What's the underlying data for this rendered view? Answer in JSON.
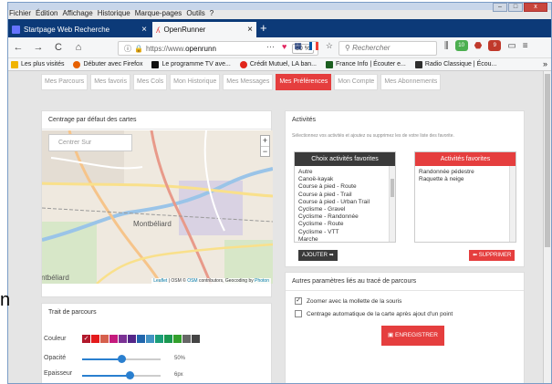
{
  "window": {
    "controls": [
      "–",
      "□",
      "x"
    ]
  },
  "menu": [
    "Fichier",
    "Édition",
    "Affichage",
    "Historique",
    "Marque-pages",
    "Outils",
    "?"
  ],
  "tabs": [
    {
      "label": "Startpage Web Recherche",
      "active": false
    },
    {
      "label": "OpenRunner",
      "active": true
    }
  ],
  "nav": {
    "back": "←",
    "forward": "→",
    "reload": "C",
    "home": "⌂",
    "url_prefix": "https://www.",
    "url_host": "openrunn",
    "zoom": "80 %",
    "more": "···",
    "search_placeholder": "Rechercher",
    "badge1": "10",
    "badge2": "9"
  },
  "bookmarks": [
    {
      "label": "Les plus visités",
      "icon": "star-icon",
      "color": "#f0b400"
    },
    {
      "label": "Débuter avec Firefox",
      "icon": "firefox-icon",
      "color": "#e66000"
    },
    {
      "label": "Le programme TV ave...",
      "icon": "tv-icon",
      "color": "#111111"
    },
    {
      "label": "Crédit Mutuel, LA ban...",
      "icon": "bank-icon",
      "color": "#e1251b"
    },
    {
      "label": "France Info | Écouter e...",
      "icon": "radio-icon",
      "color": "#1b5e20"
    },
    {
      "label": "Radio Classique | Écou...",
      "icon": "radio-icon",
      "color": "#2e2e2e"
    }
  ],
  "subnav": [
    {
      "label": "Mes Parcours",
      "active": false
    },
    {
      "label": "Mes favoris",
      "active": false
    },
    {
      "label": "Mes Cols",
      "active": false
    },
    {
      "label": "Mon Historique",
      "active": false
    },
    {
      "label": "Mes Messages",
      "active": false
    },
    {
      "label": "Mes Préférences",
      "active": true
    },
    {
      "label": "Mon Compte",
      "active": false
    },
    {
      "label": "Mes Abonnements",
      "active": false
    }
  ],
  "map_panel": {
    "title": "Centrage par défaut des cartes",
    "search_placeholder": "Centrer Sur",
    "zoom_in": "+",
    "zoom_out": "−",
    "city": "Montbéliard",
    "city2": "Montbéliard",
    "attribution_leaflet": "Leaflet",
    "attribution_sep": " | OSM © ",
    "attribution_osm": "OSM",
    "attribution_rest": " contributors, Geocoding by ",
    "attribution_photon": "Photon"
  },
  "track_panel": {
    "title": "Trait de parcours",
    "color_label": "Couleur",
    "colors": [
      "#b2182b",
      "#e41a1c",
      "#d6604d",
      "#c51b7d",
      "#7b3294",
      "#542788",
      "#2166ac",
      "#4393c3",
      "#1b9e77",
      "#1a9850",
      "#33a02c",
      "#666666",
      "#444444"
    ],
    "opacity_label": "Opacité",
    "opacity_value": "50%",
    "opacity": 0.5,
    "thickness_label": "Epaisseur",
    "thickness_value": "6px",
    "thickness": 0.6
  },
  "activities_panel": {
    "title": "Activités",
    "hint": "Sélectionnez vos activités et ajoutez ou supprimez les de votre liste des favorite.",
    "choose_header": "Choix activités favorites",
    "choose_items": [
      "Autre",
      "Canoë-kayak",
      "Course à pied - Route",
      "Course à pied - Trail",
      "Course à pied - Urban Trail",
      "Cyclisme - Gravel",
      "Cyclisme - Randonnée",
      "Cyclisme - Route",
      "Cyclisme - VTT",
      "Marche"
    ],
    "fav_header": "Activités favorites",
    "fav_items": [
      "Randonnée pédestre",
      "Raquette à neige"
    ],
    "add_button": "AJOUTER ➡",
    "remove_button": "⬅ SUPPRIMER",
    "header_dark": "#3a3a3a",
    "header_red": "#e53e3e"
  },
  "other_panel": {
    "title": "Autres paramètres liés au tracé de parcours",
    "option1": "Zoomer avec la mollette de la souris",
    "option1_checked": true,
    "option2": "Centrage automatique de la carte après ajout d'un point",
    "option2_checked": false,
    "save_button": "ENREGISTRER"
  },
  "side_char": "n"
}
